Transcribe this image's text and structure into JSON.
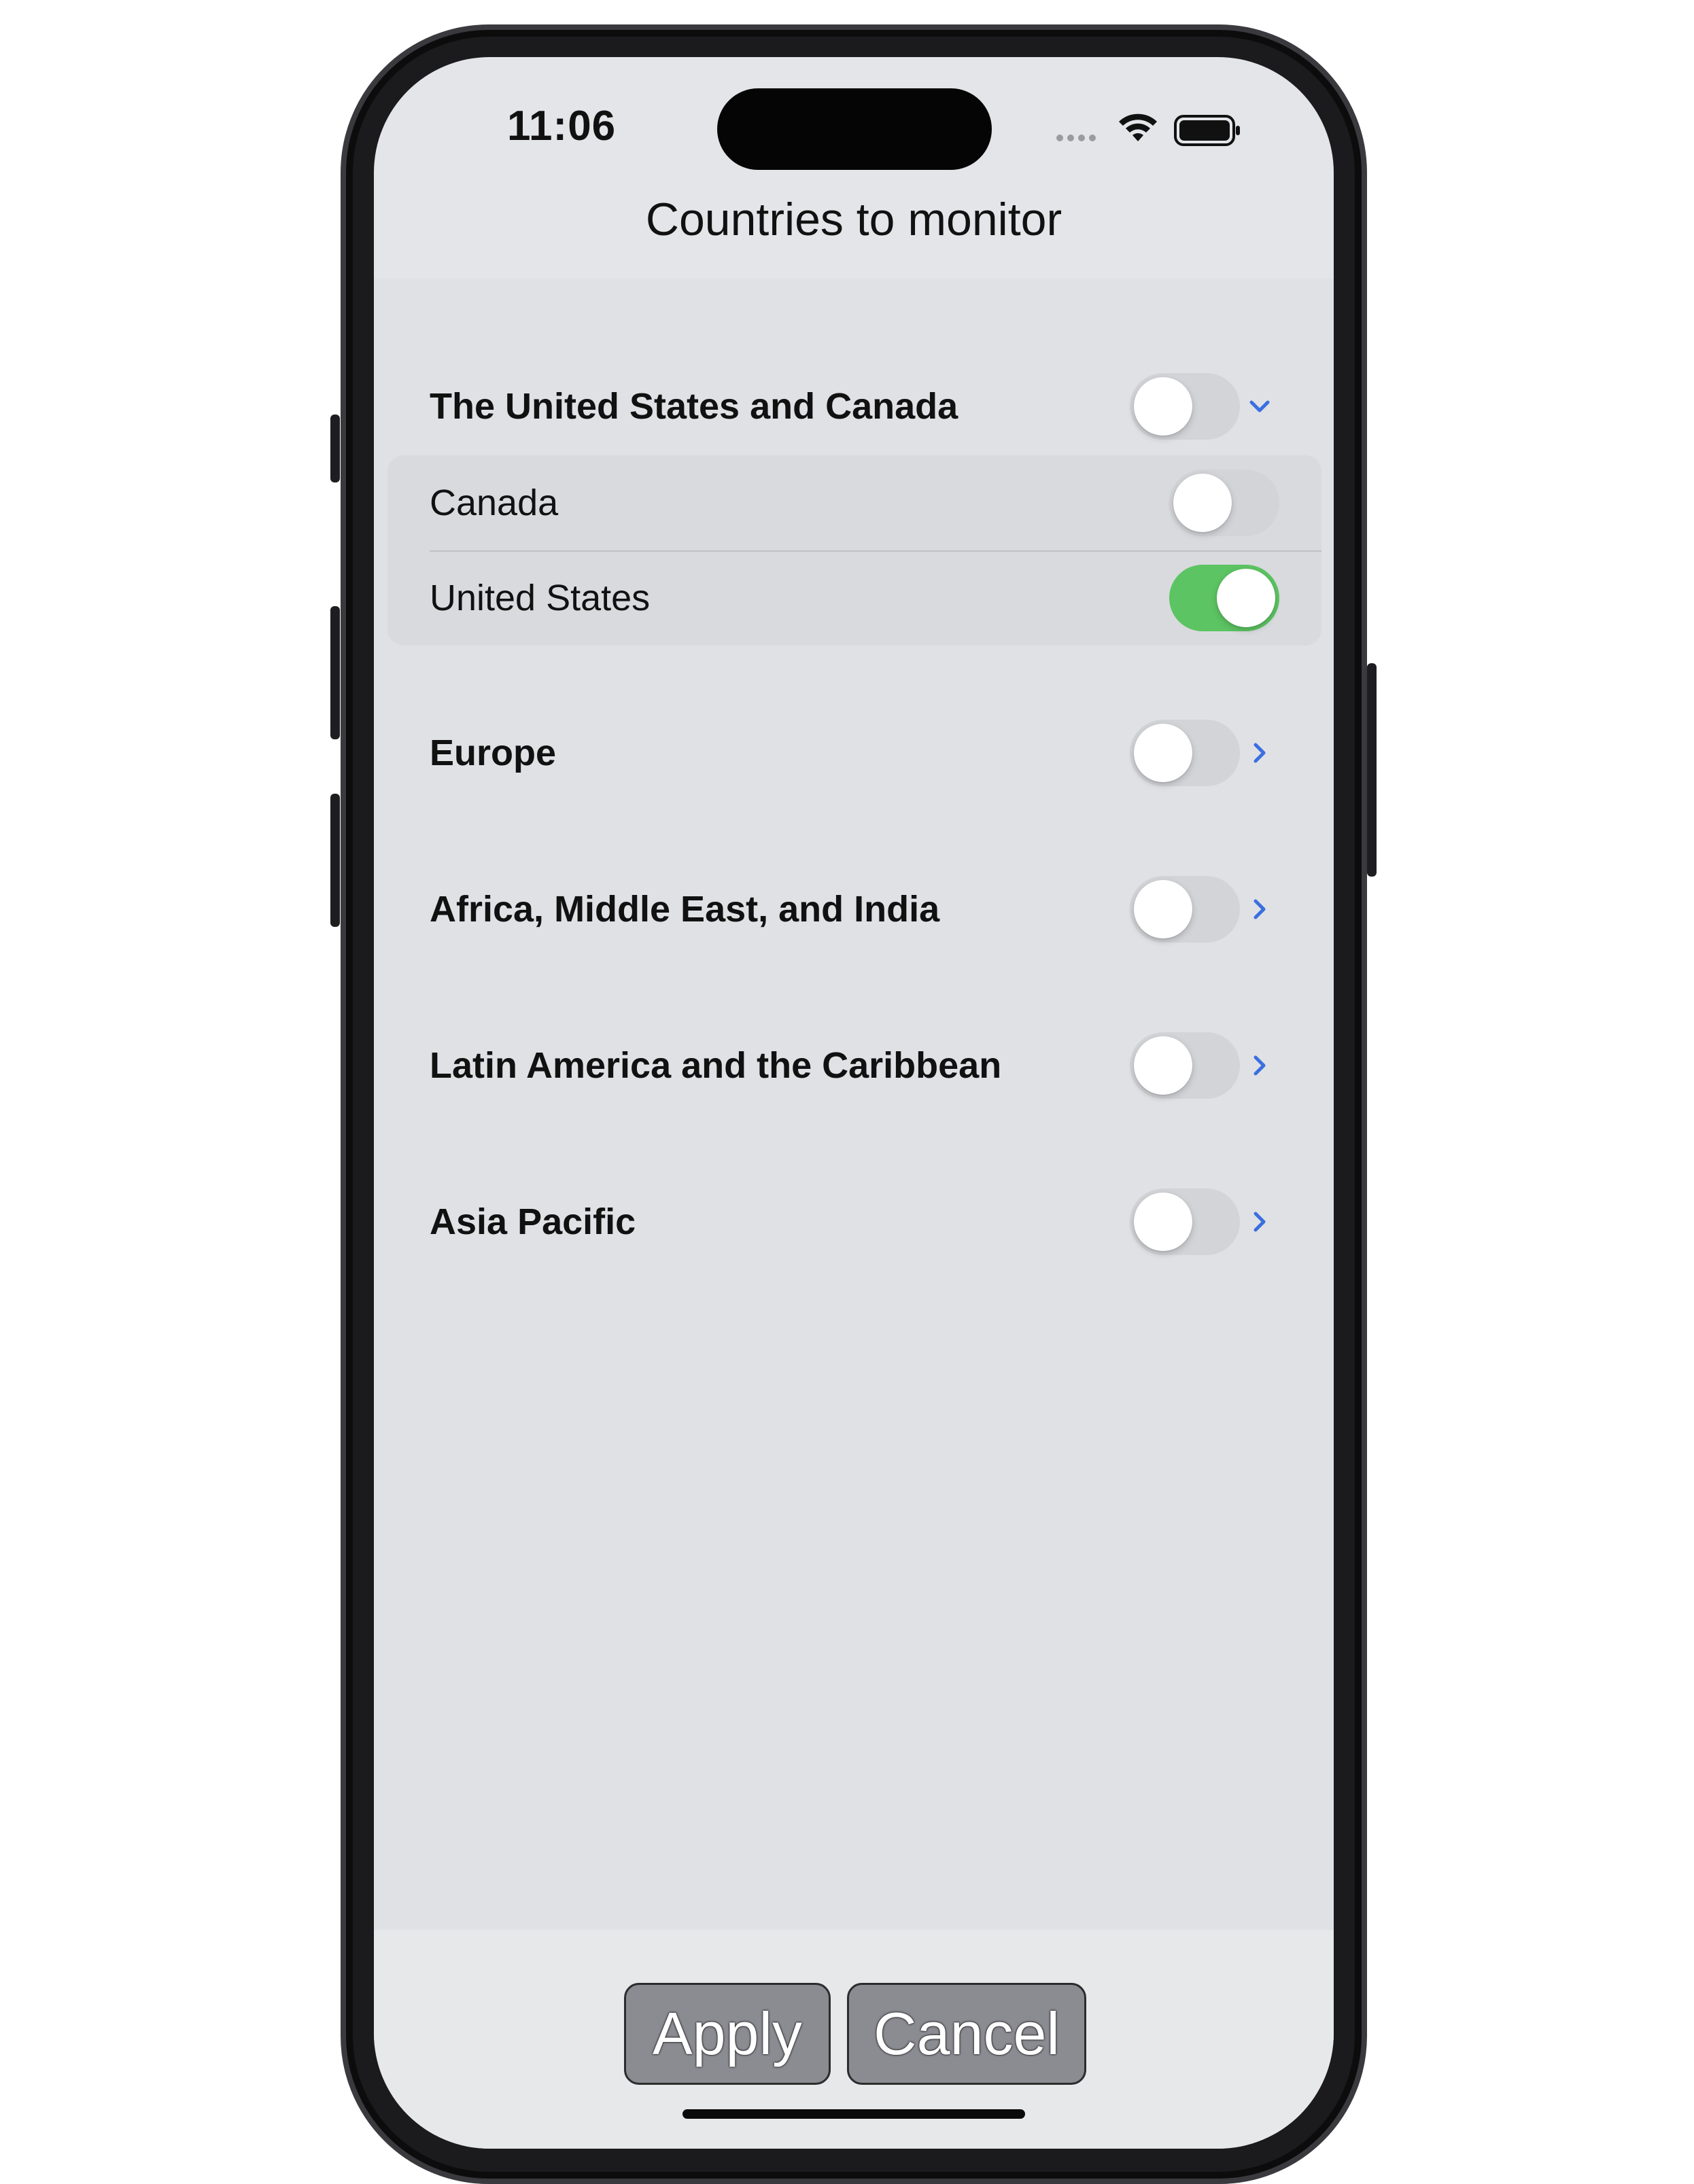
{
  "status_bar": {
    "time": "11:06",
    "signal_icon": "signal-dots-icon",
    "wifi_icon": "wifi-icon",
    "battery_icon": "battery-icon"
  },
  "nav": {
    "title": "Countries to monitor"
  },
  "regions": [
    {
      "label": "The United States and Canada",
      "enabled": false,
      "expanded": true,
      "chevron_icon": "chevron-down-icon",
      "countries": [
        {
          "label": "Canada",
          "enabled": false
        },
        {
          "label": "United States",
          "enabled": true
        }
      ]
    },
    {
      "label": "Europe",
      "enabled": false,
      "expanded": false,
      "chevron_icon": "chevron-right-icon"
    },
    {
      "label": "Africa, Middle East, and India",
      "enabled": false,
      "expanded": false,
      "chevron_icon": "chevron-right-icon"
    },
    {
      "label": "Latin America and the Caribbean",
      "enabled": false,
      "expanded": false,
      "chevron_icon": "chevron-right-icon"
    },
    {
      "label": "Asia Pacific",
      "enabled": false,
      "expanded": false,
      "chevron_icon": "chevron-right-icon"
    }
  ],
  "actions": {
    "apply_label": "Apply",
    "cancel_label": "Cancel"
  },
  "colors": {
    "toggle_on": "#5cc462",
    "toggle_off": "#d3d4d8",
    "accent_chevron": "#3a6fe0"
  }
}
